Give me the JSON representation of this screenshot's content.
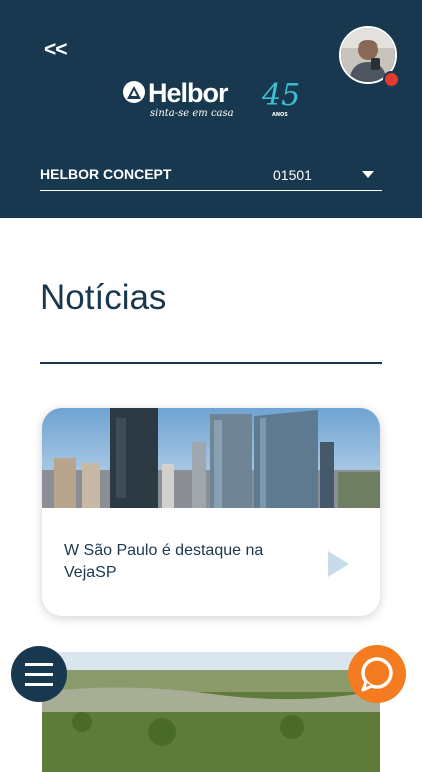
{
  "header": {
    "back_label": "<<",
    "brand": {
      "name": "Helbor",
      "tagline": "sinta-se em casa",
      "years": "45",
      "years_label": "ANOS"
    },
    "selector": {
      "name": "HELBOR CONCEPT",
      "code": "01501"
    }
  },
  "main": {
    "title": "Notícias",
    "news": [
      {
        "caption": "W São Paulo é destaque na VejaSP"
      }
    ]
  },
  "colors": {
    "header_bg": "#183850",
    "accent_teal": "#3cc0d2",
    "chat_orange": "#f47b1f",
    "status_red": "#e3392f"
  },
  "icons": {
    "menu": "hamburger-icon",
    "chat": "chat-bubble-icon",
    "play": "play-icon",
    "dropdown": "caret-down-icon"
  }
}
